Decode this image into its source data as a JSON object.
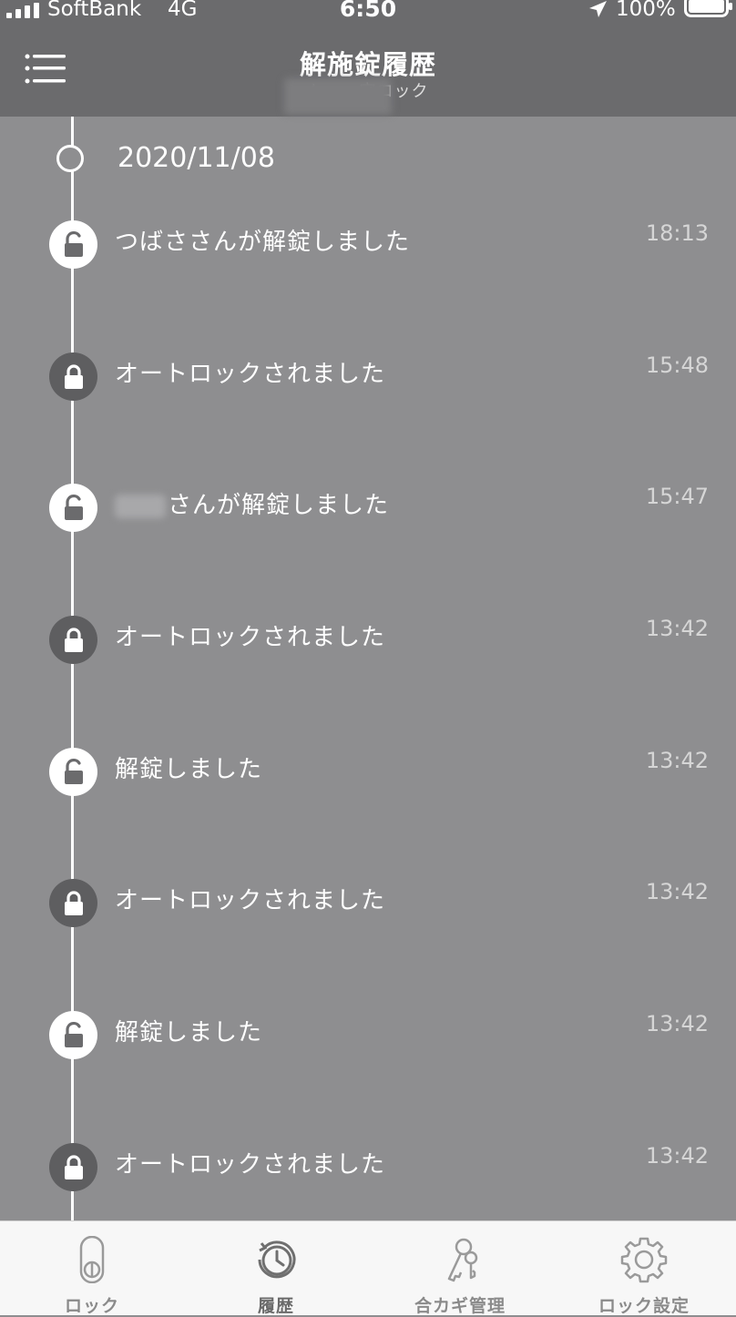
{
  "status_bar": {
    "carrier": "SoftBank",
    "network": "4G",
    "time": "6:50",
    "battery": "100%"
  },
  "header": {
    "title": "解施錠履歴",
    "subtitle": "ト　　宅ロック",
    "menu_icon": "hamburger-menu-icon"
  },
  "timeline": {
    "date": "2020/11/08",
    "entries": [
      {
        "text": "つばささんが解錠しました",
        "time": "18:13",
        "state": "unlocked"
      },
      {
        "text": "オートロックされました",
        "time": "15:48",
        "state": "locked"
      },
      {
        "text": "さんが解錠しました",
        "time": "15:47",
        "state": "unlocked",
        "name_redacted": true
      },
      {
        "text": "オートロックされました",
        "time": "13:42",
        "state": "locked"
      },
      {
        "text": "解錠しました",
        "time": "13:42",
        "state": "unlocked"
      },
      {
        "text": "オートロックされました",
        "time": "13:42",
        "state": "locked"
      },
      {
        "text": "解錠しました",
        "time": "13:42",
        "state": "unlocked"
      },
      {
        "text": "オートロックされました",
        "time": "13:42",
        "state": "locked"
      }
    ]
  },
  "tab_bar": {
    "tabs": [
      {
        "label": "ロック",
        "icon": "lock-toggle-icon"
      },
      {
        "label": "履歴",
        "icon": "history-clock-icon",
        "active": true
      },
      {
        "label": "合カギ管理",
        "icon": "keys-icon"
      },
      {
        "label": "ロック設定",
        "icon": "gear-icon"
      }
    ]
  },
  "colors": {
    "header_bg": "#6b6b6d",
    "content_bg": "#8e8e90",
    "tab_bar_bg": "#f7f7f7",
    "locked_icon_bg": "#5e5e60",
    "unlocked_icon_bg": "#ffffff"
  }
}
